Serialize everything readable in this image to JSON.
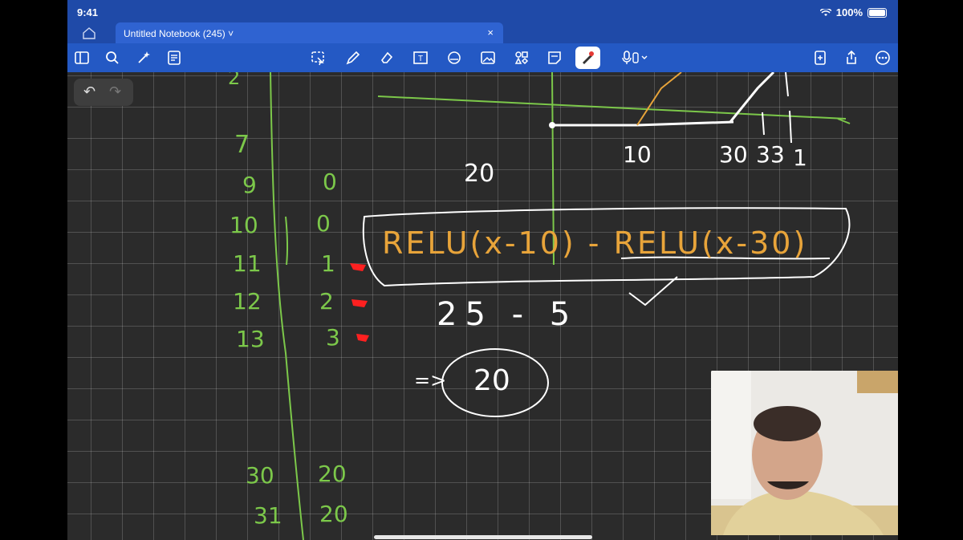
{
  "status": {
    "time": "9:41",
    "battery": "100%"
  },
  "tab": {
    "title": "Untitled Notebook (245) ˅",
    "close": "×"
  },
  "toolbar": {
    "left_icons": [
      "sidebar-icon",
      "search-icon",
      "magic-icon",
      "document-list-icon"
    ],
    "center_icons": [
      "lasso-icon",
      "pen-icon",
      "eraser-icon",
      "text-box-icon",
      "shapes-icon",
      "image-icon",
      "elements-icon",
      "sticky-note-icon",
      "laser-pointer-icon",
      "microphone-icon"
    ],
    "right_icons": [
      "add-page-icon",
      "share-icon",
      "more-icon"
    ]
  },
  "notes": {
    "left_column_a": [
      "2",
      "7",
      "9",
      "10",
      "11",
      "12",
      "13",
      "30",
      "31"
    ],
    "left_column_b": [
      "0",
      "0",
      "1",
      "2",
      "3",
      "20",
      "20"
    ],
    "axis_labels": [
      "10",
      "30",
      "3",
      "3",
      "1"
    ],
    "value_20": "20",
    "relu_expression": "RELU(x-10) - RELU(x-30)",
    "calc": "25 - 5",
    "result_arrow": "=>",
    "result": "20"
  },
  "colors": {
    "toolbar": "#2459c4",
    "tab_active": "#2f63d1",
    "ink_green": "#7cc84a",
    "ink_orange": "#e8a43a",
    "ink_white": "#ffffff",
    "ink_red": "#ff2020"
  }
}
